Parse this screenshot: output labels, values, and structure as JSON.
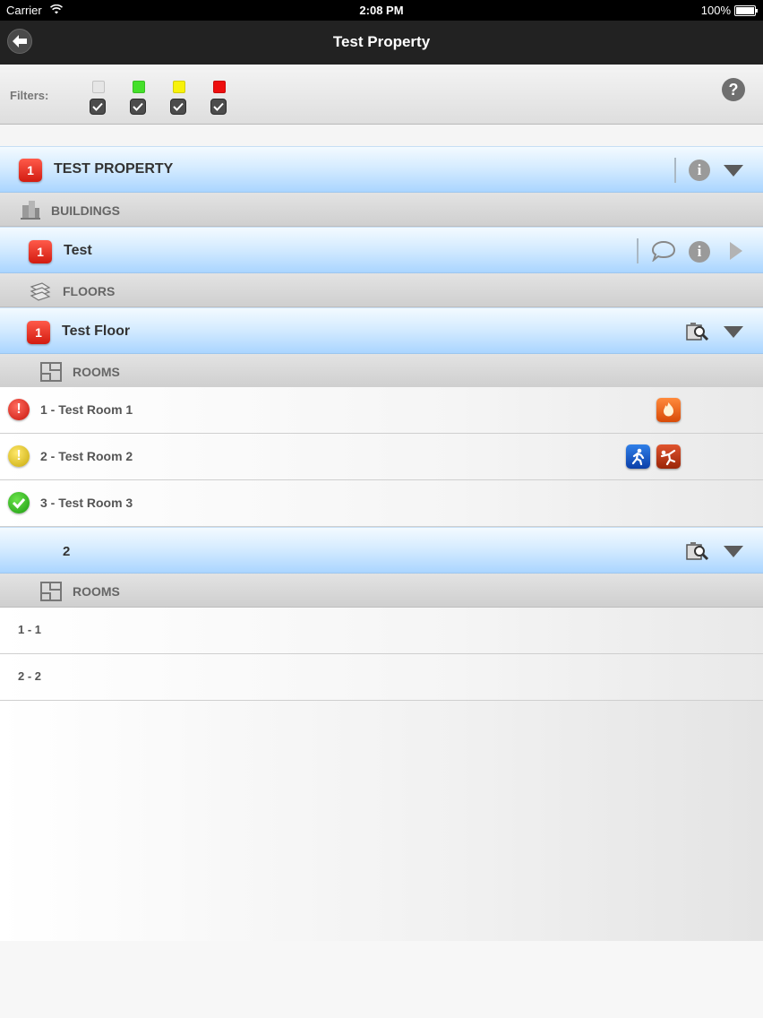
{
  "status_bar": {
    "carrier": "Carrier",
    "time": "2:08 PM",
    "battery": "100%"
  },
  "nav": {
    "title": "Test Property",
    "back_icon": "back-arrow-icon"
  },
  "filters": {
    "label": "Filters:",
    "items": [
      {
        "color": "#e6e6e6",
        "checked": true
      },
      {
        "color": "#44e02a",
        "checked": true
      },
      {
        "color": "#f8f20a",
        "checked": true
      },
      {
        "color": "#ee0e0e",
        "checked": true
      }
    ],
    "help_label": "?"
  },
  "property": {
    "badge": "1",
    "title": "TEST PROPERTY"
  },
  "buildings_section": {
    "label": "BUILDINGS"
  },
  "building": {
    "badge": "1",
    "title": "Test"
  },
  "floors_section": {
    "label": "FLOORS"
  },
  "floor1": {
    "badge": "1",
    "title": "Test Floor",
    "rooms_label": "ROOMS",
    "rooms": [
      {
        "label": "1 - Test Room 1",
        "status": "error",
        "icons": [
          "fire-hand-icon"
        ]
      },
      {
        "label": "2 - Test Room 2",
        "status": "warning",
        "icons": [
          "running-person-icon",
          "falling-person-icon"
        ]
      },
      {
        "label": "3 - Test Room 3",
        "status": "ok",
        "icons": []
      }
    ]
  },
  "floor2": {
    "title": "2",
    "rooms_label": "ROOMS",
    "rooms": [
      {
        "label": "1 - 1"
      },
      {
        "label": "2 - 2"
      }
    ]
  }
}
